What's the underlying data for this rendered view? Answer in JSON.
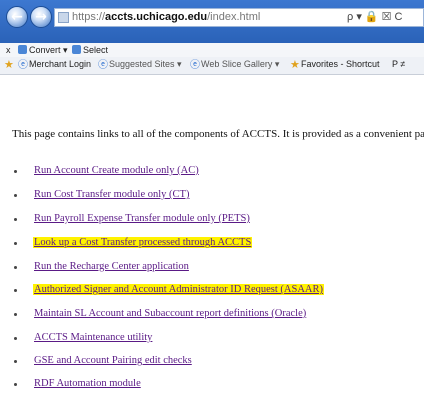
{
  "browser": {
    "url_prefix": "https://",
    "url_host": "accts.uchicago.edu",
    "url_path": "/index.html",
    "address_tools": "ρ ▾ 🔒 ☒ C"
  },
  "toolbar1": {
    "close_label": "x",
    "convert_label": "Convert",
    "select_label": "Select"
  },
  "favorites_bar": {
    "items": [
      {
        "label": "Merchant Login"
      },
      {
        "label": "Suggested Sites ▾"
      },
      {
        "label": "Web Slice Gallery ▾"
      },
      {
        "label": "Favorites - Shortcut"
      },
      {
        "label": "P ≠"
      }
    ]
  },
  "page": {
    "intro": "This page contains links to all of the components of ACCTS. It is provided as a convenient pa",
    "links": [
      {
        "label": "Run Account Create module only (AC)"
      },
      {
        "label": "Run Cost Transfer module only (CT)"
      },
      {
        "label": "Run Payroll Expense Transfer module only (PETS)"
      },
      {
        "label": "Look up a Cost Transfer processed through ACCTS",
        "highlighted": true
      },
      {
        "label": "Run the Recharge Center application"
      },
      {
        "label": "Authorized Signer and Account Administrator ID Request (ASAAR)",
        "highlighted": true
      },
      {
        "label": "Maintain SL Account and Subaccount report definitions (Oracle)"
      },
      {
        "label": "ACCTS Maintenance utility"
      },
      {
        "label": "GSE and Account Pairing edit checks"
      },
      {
        "label": "RDF Automation module"
      }
    ]
  },
  "colors": {
    "chrome_blue": "#2a62b8",
    "link_visited": "#5a1a86",
    "highlight": "#fff200"
  }
}
